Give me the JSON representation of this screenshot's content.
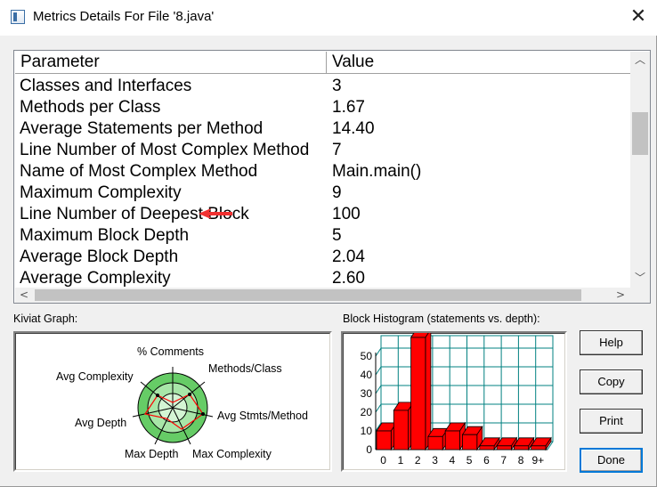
{
  "window": {
    "title": "Metrics Details For File '8.java'",
    "close_glyph": "✕"
  },
  "table": {
    "headers": [
      "Parameter",
      "Value"
    ],
    "rows": [
      [
        "Classes and Interfaces",
        "3"
      ],
      [
        "Methods per Class",
        "1.67"
      ],
      [
        "Average Statements per Method",
        "14.40"
      ],
      [
        "Line Number of Most Complex Method",
        "7"
      ],
      [
        "Name of Most Complex Method",
        "Main.main()"
      ],
      [
        "Maximum Complexity",
        "9"
      ],
      [
        "Line Number of Deepest Block",
        "100"
      ],
      [
        "Maximum Block Depth",
        "5"
      ],
      [
        "Average Block Depth",
        "2.04"
      ],
      [
        "Average Complexity",
        "2.60"
      ]
    ],
    "annotation_color": "#f03030"
  },
  "kiviat": {
    "label": "Kiviat Graph:",
    "axes": [
      "% Comments",
      "Methods/Class",
      "Avg Stmts/Method",
      "Max Complexity",
      "Max Depth",
      "Avg Depth",
      "Avg Complexity"
    ]
  },
  "histogram": {
    "label": "Block Histogram (statements vs. depth):",
    "bar_color": "#ff0000",
    "grid_color": "#008080"
  },
  "buttons": {
    "help": "Help",
    "copy": "Copy",
    "print": "Print",
    "done": "Done"
  },
  "chart_data": {
    "type": "bar",
    "categories": [
      "0",
      "1",
      "2",
      "3",
      "4",
      "5",
      "6",
      "7",
      "8",
      "9+"
    ],
    "values": [
      10,
      21,
      60,
      7,
      10,
      8,
      2,
      2,
      2,
      2
    ],
    "ylim": [
      0,
      50
    ],
    "yticks": [
      0,
      10,
      20,
      30,
      40,
      50
    ]
  }
}
